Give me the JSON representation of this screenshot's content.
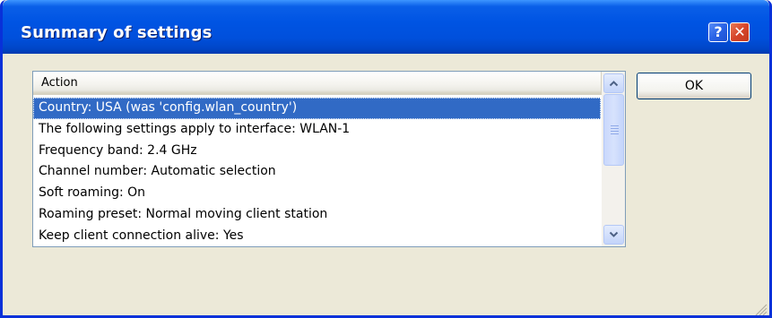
{
  "window": {
    "title": "Summary of settings",
    "help_glyph": "?",
    "close_glyph": "✕"
  },
  "list": {
    "column_header": "Action",
    "rows": [
      "Country: USA (was 'config.wlan_country')",
      "The following settings apply to interface: WLAN-1",
      "Frequency band: 2.4 GHz",
      "Channel number: Automatic selection",
      "Soft roaming: On",
      "Roaming preset: Normal moving client station",
      "Keep client connection alive: Yes"
    ],
    "selected_index": 0
  },
  "buttons": {
    "ok_label": "OK"
  },
  "icons": {
    "help": "help-icon",
    "close": "close-icon",
    "scroll_up": "chevron-up-icon",
    "scroll_down": "chevron-down-icon",
    "resize": "resize-grip-icon"
  },
  "colors": {
    "title_bar": "#0054e3",
    "selection": "#316ac5",
    "dialog_bg": "#ece9d8",
    "close_button": "#d6452a"
  }
}
